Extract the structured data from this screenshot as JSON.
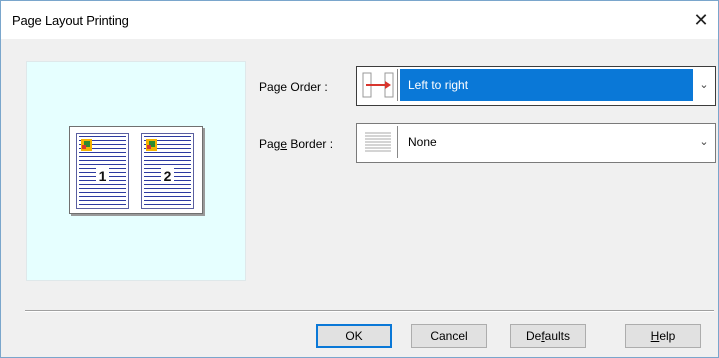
{
  "window": {
    "title": "Page Layout Printing",
    "close_glyph": "✕"
  },
  "preview": {
    "page_numbers": [
      "1",
      "2"
    ]
  },
  "page_order": {
    "label_pre": "Pa",
    "label_u": "g",
    "label_post": "e Order :",
    "value": "Left to right",
    "icon": "arrow-left-to-right-icon"
  },
  "page_border": {
    "label_pre": "Pag",
    "label_u": "e",
    "label_post": " Border :",
    "value": "None",
    "icon": "no-border-icon"
  },
  "buttons": {
    "ok": "OK",
    "cancel": "Cancel",
    "defaults_pre": "De",
    "defaults_u": "f",
    "defaults_post": "aults",
    "help_pre": "",
    "help_u": "H",
    "help_post": "elp"
  },
  "colors": {
    "selection": "#0a78d7",
    "preview_bg": "#e6ffff",
    "arrow": "#d8362e"
  }
}
